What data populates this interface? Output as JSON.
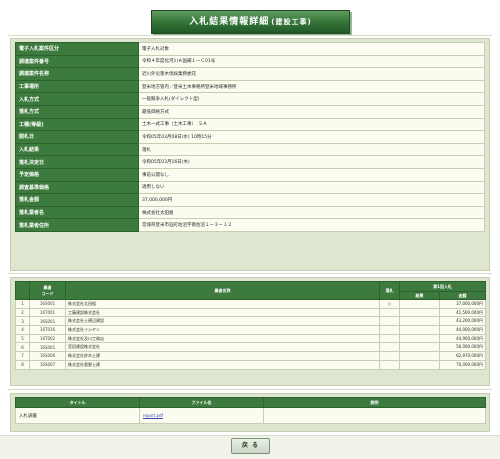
{
  "header": {
    "title": "入札結果情報詳細",
    "subtitle": "(建設工事)"
  },
  "info": [
    {
      "label": "電子入札案件区分",
      "value": "電子入札対象"
    },
    {
      "label": "調達案件番号",
      "value": "令和４年度化河川Ａ国補１ーＣ01号"
    },
    {
      "label": "調達案件名称",
      "value": "近川外災害木伐採業務委託"
    },
    {
      "label": "工事場所",
      "value": "登米地方管内／登米土木事務所登米地域事務所"
    },
    {
      "label": "入札方式",
      "value": "一般競争入札(ダイレクト型)"
    },
    {
      "label": "落札方式",
      "value": "最低価格方式"
    },
    {
      "label": "工種(等級)",
      "value": "土木一式工事（土木工事）　ＳＡ"
    },
    {
      "label": "開札日",
      "value": "令和05年03月08日(水) 10時15分"
    },
    {
      "label": "入札結果",
      "value": "落札"
    },
    {
      "label": "落札決定日",
      "value": "令和05年03月16日(木)"
    },
    {
      "label": "予定価格",
      "value": "事前公開なし"
    },
    {
      "label": "調査基準価格",
      "value": "適用しない"
    },
    {
      "label": "落札金額",
      "value": "37,000,000円"
    },
    {
      "label": "落札業者名",
      "value": "株式会社太田組"
    },
    {
      "label": "落札業者住所",
      "value": "宮城県登米市迫町佐沼字南佐沼１ー３ー１２"
    }
  ],
  "bids": {
    "headers": {
      "no": "",
      "code": "業者\nコード",
      "name": "業者名称",
      "won": "落札",
      "amount_group": "第1回入札",
      "result": "結果",
      "amount": "金額"
    },
    "rows": [
      {
        "no": "1",
        "code": "16S001",
        "name": "株式会社太田組",
        "won": "○",
        "result": "",
        "amount": "37,000,000円"
      },
      {
        "no": "2",
        "code": "16T001",
        "name": "工藤建設株式会社",
        "won": "",
        "result": "",
        "amount": "41,500,000円"
      },
      {
        "no": "3",
        "code": "16S001",
        "name": "株式会社土建辺建設",
        "won": "",
        "result": "",
        "amount": "43,200,000円"
      },
      {
        "no": "4",
        "code": "16T016",
        "name": "株式会社イシヤン",
        "won": "",
        "result": "",
        "amount": "44,000,000円"
      },
      {
        "no": "5",
        "code": "16T002",
        "name": "株式会社及川工務店",
        "won": "",
        "result": "",
        "amount": "44,900,000円"
      },
      {
        "no": "6",
        "code": "16S001",
        "name": "宮田建設株式会社",
        "won": "",
        "result": "",
        "amount": "56,000,000円"
      },
      {
        "no": "7",
        "code": "16S006",
        "name": "株式会社鈴木土建",
        "won": "",
        "result": "",
        "amount": "62,970,000円"
      },
      {
        "no": "8",
        "code": "16S007",
        "name": "株式会社奥野土建",
        "won": "",
        "result": "",
        "amount": "70,000,000円"
      }
    ]
  },
  "files": {
    "headers": {
      "title": "タイトル",
      "file": "ファイル名",
      "note": "説明"
    },
    "rows": [
      {
        "title": "入札調書",
        "file": "report.pdf",
        "note": ""
      }
    ]
  },
  "footer": {
    "back_label": "戻 る"
  },
  "colors": {
    "header_green": "#3c7a3d",
    "panel_bg": "#dfe6cf",
    "cell_bg": "#fbfbef"
  }
}
